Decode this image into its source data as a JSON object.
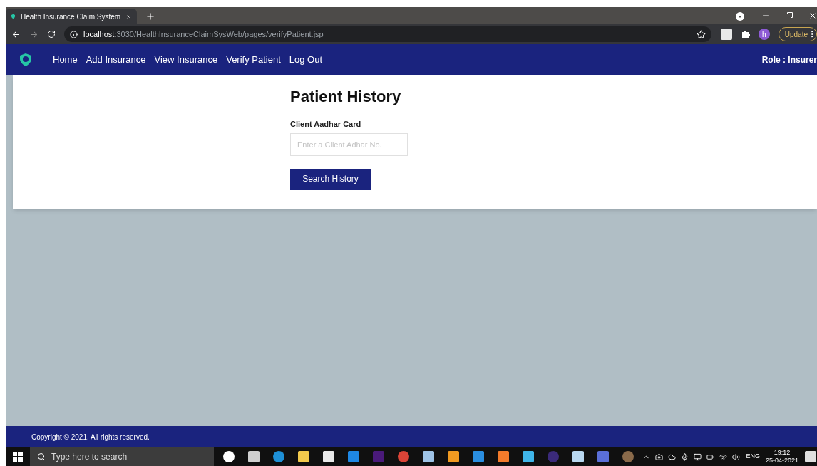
{
  "browser": {
    "tab_title": "Health Insurance Claim System",
    "url_host": "localhost",
    "url_path": ":3030/HealthInsuranceClaimSysWeb/pages/verifyPatient.jsp",
    "profile_letter": "h",
    "update_label": "Update"
  },
  "nav": {
    "items": [
      {
        "label": "Home"
      },
      {
        "label": "Add Insurance"
      },
      {
        "label": "View Insurance"
      },
      {
        "label": "Verify Patient"
      },
      {
        "label": "Log Out"
      }
    ],
    "role": "Role : Insurer"
  },
  "form": {
    "heading": "Patient History",
    "field_label": "Client Aadhar Card",
    "placeholder": "Enter a Client Adhar No.",
    "button": "Search History"
  },
  "footer": {
    "copyright": "Copyright © 2021. All rights reserved."
  },
  "taskbar": {
    "search_placeholder": "Type here to search",
    "language": "ENG",
    "time": "19:12",
    "date": "25-04-2021"
  }
}
